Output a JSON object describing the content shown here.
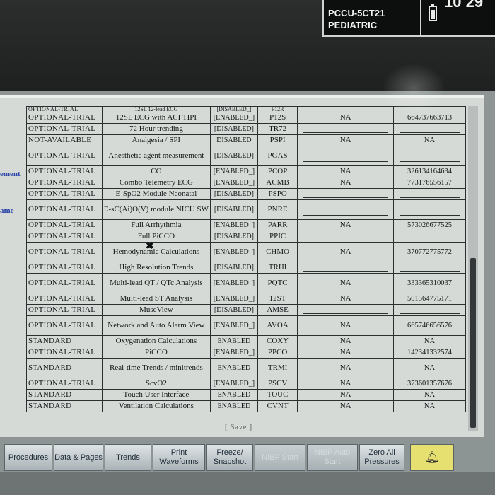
{
  "header": {
    "unit": "PCCU-5CT21",
    "patient_type": "PEDIATRIC",
    "clock": "10 29",
    "battery_level": 0.7
  },
  "left_labels": [
    "ement",
    "ame"
  ],
  "table": {
    "rows": [
      {
        "state": "OPTIONAL-TRIAL",
        "option": "12SL 12-lead ECG",
        "status": "[DISABLED_]",
        "code": "P12R",
        "license": "",
        "key": "",
        "cut": true
      },
      {
        "state": "OPTIONAL-TRIAL",
        "option": "12SL ECG with ACI TIPI",
        "status": "[ENABLED_]",
        "code": "P12S",
        "license": "NA",
        "key": "664737663713"
      },
      {
        "state": "OPTIONAL-TRIAL",
        "option": "72 Hour trending",
        "status": "[DISABLED]",
        "code": "TR72",
        "license": "",
        "key": ""
      },
      {
        "state": "NOT-AVAILABLE",
        "option": "Analgesia / SPI",
        "status": "DISABLED",
        "code": "PSPI",
        "license": "NA",
        "key": "NA"
      },
      {
        "state": "OPTIONAL-TRIAL",
        "option": "Anesthetic agent measurement",
        "status": "[DISABLED]",
        "code": "PGAS",
        "license": "",
        "key": "",
        "tall": true
      },
      {
        "state": "OPTIONAL-TRIAL",
        "option": "CO",
        "status": "[ENABLED_]",
        "code": "PCOP",
        "license": "NA",
        "key": "326134164634"
      },
      {
        "state": "OPTIONAL-TRIAL",
        "option": "Combo Telemetry ECG",
        "status": "[ENABLED_]",
        "code": "ACMB",
        "license": "NA",
        "key": "773176556157"
      },
      {
        "state": "OPTIONAL-TRIAL",
        "option": "E-SpO2 Module Neonatal",
        "status": "[DISABLED]",
        "code": "PSPO",
        "license": "",
        "key": ""
      },
      {
        "state": "OPTIONAL-TRIAL",
        "option": "E-sC(Ai)O(V) module NICU SW",
        "status": "[DISABLED]",
        "code": "PNRE",
        "license": "",
        "key": "",
        "tall": true
      },
      {
        "state": "OPTIONAL-TRIAL",
        "option": "Full Arrhythmia",
        "status": "[ENABLED_]",
        "code": "PARR",
        "license": "NA",
        "key": "573026677525"
      },
      {
        "state": "OPTIONAL-TRIAL",
        "option": "Full PiCCO",
        "status": "[DISABLED]",
        "code": "PPIC",
        "license": "",
        "key": ""
      },
      {
        "state": "OPTIONAL-TRIAL",
        "option": "Hemodynamic Calculations",
        "status": "[ENABLED_]",
        "code": "CHMO",
        "license": "NA",
        "key": "370772775772",
        "tall": true
      },
      {
        "state": "OPTIONAL-TRIAL",
        "option": "High Resolution Trends",
        "status": "[DISABLED]",
        "code": "TRHI",
        "license": "",
        "key": ""
      },
      {
        "state": "OPTIONAL-TRIAL",
        "option": "Multi-lead QT / QTc Analysis",
        "status": "[ENABLED_]",
        "code": "PQTC",
        "license": "NA",
        "key": "333365310037",
        "tall": true
      },
      {
        "state": "OPTIONAL-TRIAL",
        "option": "Multi-lead ST Analysis",
        "status": "[ENABLED_]",
        "code": "12ST",
        "license": "NA",
        "key": "501564775171"
      },
      {
        "state": "OPTIONAL-TRIAL",
        "option": "MuseView",
        "status": "[DISABLED]",
        "code": "AMSE",
        "license": "",
        "key": ""
      },
      {
        "state": "OPTIONAL-TRIAL",
        "option": "Network and Auto Alarm View",
        "status": "[ENABLED_]",
        "code": "AVOA",
        "license": "NA",
        "key": "665746656576",
        "tall": true
      },
      {
        "state": "STANDARD",
        "option": "Oxygenation Calculations",
        "status": "ENABLED",
        "code": "COXY",
        "license": "NA",
        "key": "NA"
      },
      {
        "state": "OPTIONAL-TRIAL",
        "option": "PiCCO",
        "status": "[ENABLED_]",
        "code": "PPCO",
        "license": "NA",
        "key": "142341332574"
      },
      {
        "state": "STANDARD",
        "option": "Real-time Trends / minitrends",
        "status": "ENABLED",
        "code": "TRMI",
        "license": "NA",
        "key": "NA",
        "tall": true
      },
      {
        "state": "OPTIONAL-TRIAL",
        "option": "ScvO2",
        "status": "[ENABLED_]",
        "code": "PSCV",
        "license": "NA",
        "key": "373601357676"
      },
      {
        "state": "STANDARD",
        "option": "Touch User Interface",
        "status": "ENABLED",
        "code": "TOUC",
        "license": "NA",
        "key": "NA"
      },
      {
        "state": "STANDARD",
        "option": "Ventilation Calculations",
        "status": "ENABLED",
        "code": "CVNT",
        "license": "NA",
        "key": "NA"
      }
    ]
  },
  "save_label": "[ Save ]",
  "softkeys": [
    {
      "label": "Procedures",
      "enabled": true
    },
    {
      "label": "Data & Pages",
      "enabled": true
    },
    {
      "label": "Trends",
      "enabled": true
    },
    {
      "label": "Print Waveforms",
      "enabled": true
    },
    {
      "label": "Freeze/ Snapshot",
      "enabled": true
    },
    {
      "label": "NIBP Start",
      "enabled": false
    },
    {
      "label": "NIBP Auto Start",
      "enabled": false
    },
    {
      "label": "Zero All Pressures",
      "enabled": true
    }
  ],
  "colors": {
    "alarm_button": "#e6e070",
    "panel": "#d6dad7"
  }
}
